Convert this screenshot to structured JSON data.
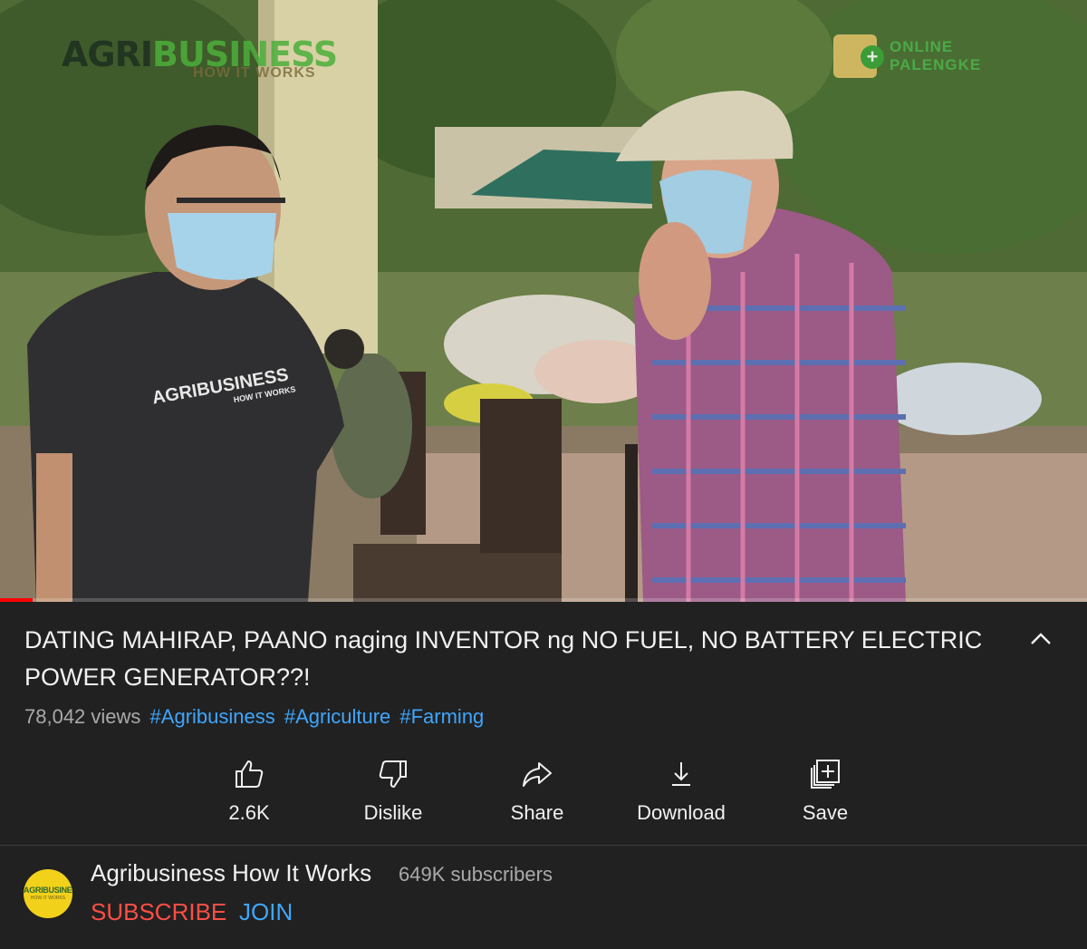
{
  "video": {
    "watermark_left": {
      "part1": "AGRI",
      "part2": "BUSINESS",
      "sub": "HOW IT WORKS"
    },
    "watermark_right": {
      "line1": "ONLINE",
      "line2": "PALENGKE"
    },
    "shirt_text": {
      "line1": "AGRIBUSINESS",
      "line2": "HOW IT WORKS"
    },
    "progress_fraction": 0.03
  },
  "title": "DATING MAHIRAP, PAANO naging INVENTOR ng NO FUEL, NO BATTERY ELECTRIC POWER GENERATOR??!",
  "views": "78,042 views",
  "hashtags": [
    "#Agribusiness",
    "#Agriculture",
    "#Farming"
  ],
  "actions": [
    {
      "icon": "thumbs-up-icon",
      "label": "2.6K"
    },
    {
      "icon": "thumbs-down-icon",
      "label": "Dislike"
    },
    {
      "icon": "share-icon",
      "label": "Share"
    },
    {
      "icon": "download-icon",
      "label": "Download"
    },
    {
      "icon": "save-playlist-icon",
      "label": "Save"
    }
  ],
  "channel": {
    "name": "Agribusiness How It Works",
    "subscribers": "649K subscribers",
    "avatar_text": {
      "line1": "AGRIBUSINESS",
      "line2": "HOW IT WORKS"
    },
    "subscribe_label": "SUBSCRIBE",
    "join_label": "JOIN"
  },
  "colors": {
    "background": "#212121",
    "link": "#3ea6ff",
    "subscribe": "#ff4e45",
    "progress": "#ff0000"
  }
}
